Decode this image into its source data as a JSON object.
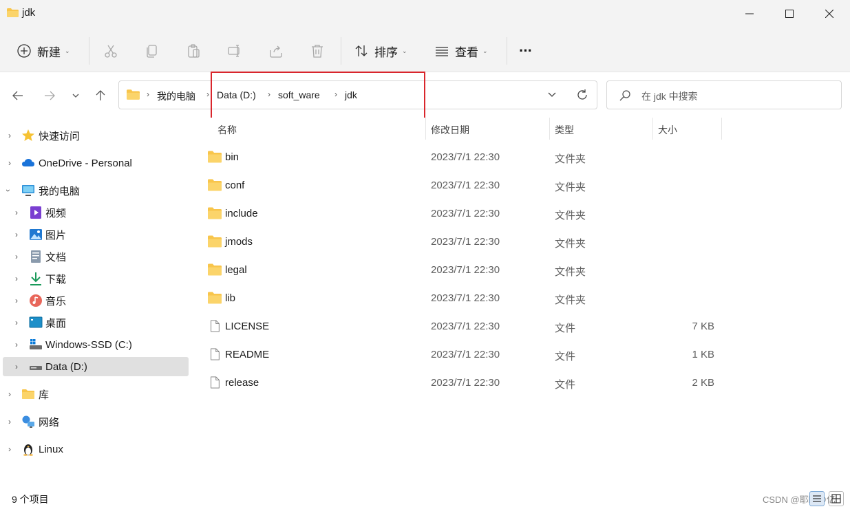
{
  "window": {
    "title": "jdk"
  },
  "toolbar": {
    "new_label": "新建",
    "sort_label": "排序",
    "view_label": "查看",
    "more_label": "···"
  },
  "breadcrumb": {
    "root": "我的电脑",
    "drive": "Data (D:)",
    "folder": "soft_ware",
    "current": "jdk"
  },
  "search": {
    "placeholder": "在 jdk 中搜索"
  },
  "sidebar": {
    "items": [
      {
        "label": "快速访问"
      },
      {
        "label": "OneDrive - Personal"
      },
      {
        "label": "我的电脑"
      },
      {
        "label": "视频"
      },
      {
        "label": "图片"
      },
      {
        "label": "文档"
      },
      {
        "label": "下载"
      },
      {
        "label": "音乐"
      },
      {
        "label": "桌面"
      },
      {
        "label": "Windows-SSD (C:)"
      },
      {
        "label": "Data (D:)"
      },
      {
        "label": "库"
      },
      {
        "label": "网络"
      },
      {
        "label": "Linux"
      }
    ]
  },
  "columns": {
    "name": "名称",
    "modified": "修改日期",
    "type": "类型",
    "size": "大小"
  },
  "files": [
    {
      "name": "bin",
      "modified": "2023/7/1 22:30",
      "type": "文件夹",
      "size": ""
    },
    {
      "name": "conf",
      "modified": "2023/7/1 22:30",
      "type": "文件夹",
      "size": ""
    },
    {
      "name": "include",
      "modified": "2023/7/1 22:30",
      "type": "文件夹",
      "size": ""
    },
    {
      "name": "jmods",
      "modified": "2023/7/1 22:30",
      "type": "文件夹",
      "size": ""
    },
    {
      "name": "legal",
      "modified": "2023/7/1 22:30",
      "type": "文件夹",
      "size": ""
    },
    {
      "name": "lib",
      "modified": "2023/7/1 22:30",
      "type": "文件夹",
      "size": ""
    },
    {
      "name": "LICENSE",
      "modified": "2023/7/1 22:30",
      "type": "文件",
      "size": "7 KB"
    },
    {
      "name": "README",
      "modified": "2023/7/1 22:30",
      "type": "文件",
      "size": "1 KB"
    },
    {
      "name": "release",
      "modified": "2023/7/1 22:30",
      "type": "文件",
      "size": "2 KB"
    }
  ],
  "status": {
    "count": "9 个项目",
    "watermark": "CSDN @耶瞄@亿"
  },
  "colors": {
    "folder": "#f8c54b",
    "accent": "#0067c0",
    "highlight_box": "#d9262c"
  }
}
